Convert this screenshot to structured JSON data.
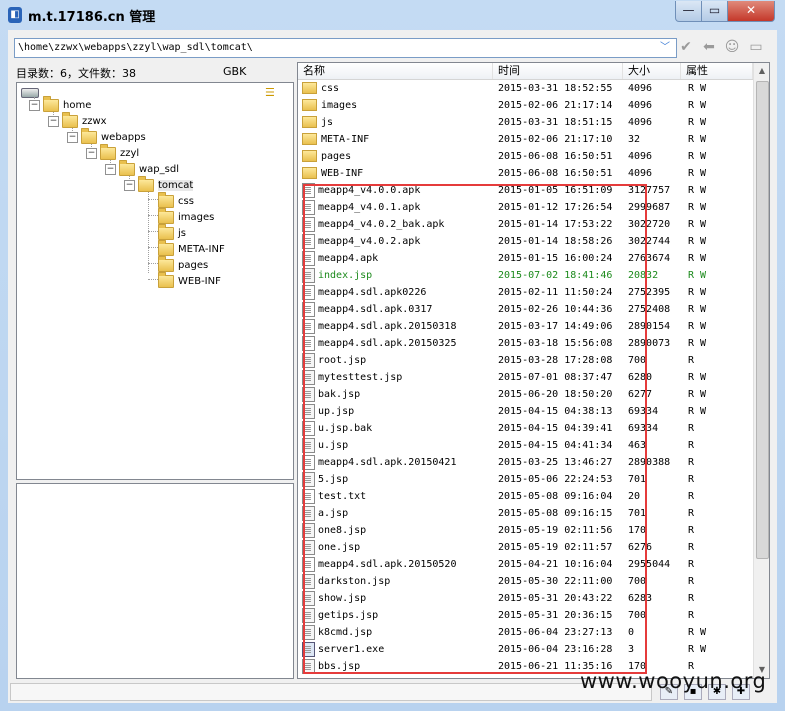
{
  "window": {
    "title": "m.t.17186.cn 管理"
  },
  "toolbar": {
    "path": "\\home\\zzwx\\webapps\\zzyl\\wap_sdl\\tomcat\\"
  },
  "left": {
    "stats": "目录数：6，文件数：38",
    "encoding": "GBK",
    "tree": [
      {
        "label": "home"
      },
      {
        "label": "zzwx"
      },
      {
        "label": "webapps"
      },
      {
        "label": "zzyl"
      },
      {
        "label": "wap_sdl"
      },
      {
        "label": "tomcat"
      },
      {
        "label": "css"
      },
      {
        "label": "images"
      },
      {
        "label": "js"
      },
      {
        "label": "META-INF"
      },
      {
        "label": "pages"
      },
      {
        "label": "WEB-INF"
      }
    ]
  },
  "list": {
    "columns": {
      "name": "名称",
      "time": "时间",
      "size": "大小",
      "attr": "属性"
    },
    "rows": [
      {
        "name": "css",
        "time": "2015-03-31 18:52:55",
        "size": "4096",
        "attr": "R W",
        "type": "folder"
      },
      {
        "name": "images",
        "time": "2015-02-06 21:17:14",
        "size": "4096",
        "attr": "R W",
        "type": "folder"
      },
      {
        "name": "js",
        "time": "2015-03-31 18:51:15",
        "size": "4096",
        "attr": "R W",
        "type": "folder"
      },
      {
        "name": "META-INF",
        "time": "2015-02-06 21:17:10",
        "size": "32",
        "attr": "R W",
        "type": "folder"
      },
      {
        "name": "pages",
        "time": "2015-06-08 16:50:51",
        "size": "4096",
        "attr": "R W",
        "type": "folder"
      },
      {
        "name": "WEB-INF",
        "time": "2015-06-08 16:50:51",
        "size": "4096",
        "attr": "R W",
        "type": "folder"
      },
      {
        "name": "meapp4_v4.0.0.apk",
        "time": "2015-01-05 16:51:09",
        "size": "3127757",
        "attr": "R W",
        "type": "file"
      },
      {
        "name": "meapp4_v4.0.1.apk",
        "time": "2015-01-12 17:26:54",
        "size": "2999687",
        "attr": "R W",
        "type": "file"
      },
      {
        "name": "meapp4_v4.0.2_bak.apk",
        "time": "2015-01-14 17:53:22",
        "size": "3022720",
        "attr": "R W",
        "type": "file"
      },
      {
        "name": "meapp4_v4.0.2.apk",
        "time": "2015-01-14 18:58:26",
        "size": "3022744",
        "attr": "R W",
        "type": "file"
      },
      {
        "name": "meapp4.apk",
        "time": "2015-01-15 16:00:24",
        "size": "2763674",
        "attr": "R W",
        "type": "file"
      },
      {
        "name": "index.jsp",
        "time": "2015-07-02 18:41:46",
        "size": "20832",
        "attr": "R W",
        "type": "jsp",
        "highlight": true
      },
      {
        "name": "meapp4.sdl.apk0226",
        "time": "2015-02-11 11:50:24",
        "size": "2752395",
        "attr": "R W",
        "type": "file"
      },
      {
        "name": "meapp4.sdl.apk.0317",
        "time": "2015-02-26 10:44:36",
        "size": "2752408",
        "attr": "R W",
        "type": "file"
      },
      {
        "name": "meapp4.sdl.apk.20150318",
        "time": "2015-03-17 14:49:06",
        "size": "2890154",
        "attr": "R W",
        "type": "file"
      },
      {
        "name": "meapp4.sdl.apk.20150325",
        "time": "2015-03-18 15:56:08",
        "size": "2890073",
        "attr": "R W",
        "type": "file"
      },
      {
        "name": "root.jsp",
        "time": "2015-03-28 17:28:08",
        "size": "700",
        "attr": "R",
        "type": "jsp"
      },
      {
        "name": "mytesttest.jsp",
        "time": "2015-07-01 08:37:47",
        "size": "6280",
        "attr": "R W",
        "type": "jsp"
      },
      {
        "name": "bak.jsp",
        "time": "2015-06-20 18:50:20",
        "size": "6277",
        "attr": "R W",
        "type": "jsp"
      },
      {
        "name": "up.jsp",
        "time": "2015-04-15 04:38:13",
        "size": "69334",
        "attr": "R W",
        "type": "jsp"
      },
      {
        "name": "u.jsp.bak",
        "time": "2015-04-15 04:39:41",
        "size": "69334",
        "attr": "R",
        "type": "file"
      },
      {
        "name": "u.jsp",
        "time": "2015-04-15 04:41:34",
        "size": "463",
        "attr": "R",
        "type": "jsp"
      },
      {
        "name": "meapp4.sdl.apk.20150421",
        "time": "2015-03-25 13:46:27",
        "size": "2890388",
        "attr": "R",
        "type": "file"
      },
      {
        "name": "5.jsp",
        "time": "2015-05-06 22:24:53",
        "size": "701",
        "attr": "R",
        "type": "jsp"
      },
      {
        "name": "test.txt",
        "time": "2015-05-08 09:16:04",
        "size": "20",
        "attr": "R",
        "type": "file"
      },
      {
        "name": "a.jsp",
        "time": "2015-05-08 09:16:15",
        "size": "701",
        "attr": "R",
        "type": "jsp"
      },
      {
        "name": "one8.jsp",
        "time": "2015-05-19 02:11:56",
        "size": "170",
        "attr": "R",
        "type": "jsp"
      },
      {
        "name": "one.jsp",
        "time": "2015-05-19 02:11:57",
        "size": "6276",
        "attr": "R",
        "type": "jsp"
      },
      {
        "name": "meapp4.sdl.apk.20150520",
        "time": "2015-04-21 10:16:04",
        "size": "2955044",
        "attr": "R",
        "type": "file"
      },
      {
        "name": "darkston.jsp",
        "time": "2015-05-30 22:11:00",
        "size": "700",
        "attr": "R",
        "type": "jsp"
      },
      {
        "name": "show.jsp",
        "time": "2015-05-31 20:43:22",
        "size": "6283",
        "attr": "R",
        "type": "jsp"
      },
      {
        "name": "getips.jsp",
        "time": "2015-05-31 20:36:15",
        "size": "700",
        "attr": "R",
        "type": "jsp"
      },
      {
        "name": "k8cmd.jsp",
        "time": "2015-06-04 23:27:13",
        "size": "0",
        "attr": "R W",
        "type": "jsp"
      },
      {
        "name": "server1.exe",
        "time": "2015-06-04 23:16:28",
        "size": "3",
        "attr": "R W",
        "type": "exe"
      },
      {
        "name": "bbs.jsp",
        "time": "2015-06-21 11:35:16",
        "size": "170",
        "attr": "R",
        "type": "jsp"
      }
    ]
  },
  "watermark": "www.wooyun.org",
  "colors": {
    "highlight": "#1c8a1c",
    "annotation_box": "#e53b3b",
    "close": "#c4382a"
  }
}
